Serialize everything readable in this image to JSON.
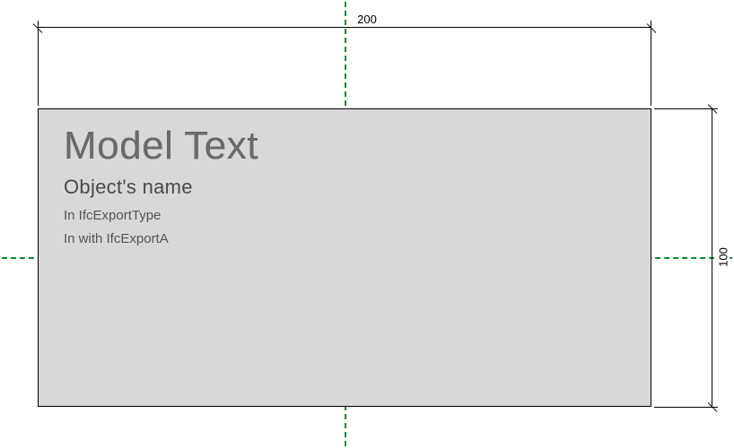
{
  "dimensions": {
    "width_label": "200",
    "height_label": "100"
  },
  "model": {
    "title": "Model Text",
    "name": "Object's name",
    "line3": "In IfcExportType",
    "line4": "In with IfcExportA"
  }
}
